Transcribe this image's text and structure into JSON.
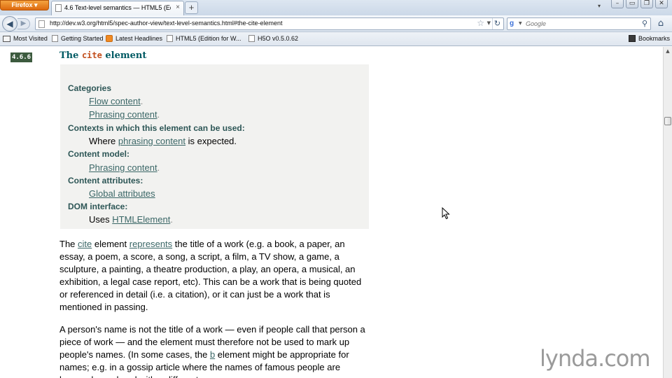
{
  "browser": {
    "app_button": "Firefox",
    "tab": {
      "title": "4.6 Text-level semantics — HTML5 (Editi...",
      "close": "×"
    },
    "new_tab": "+",
    "list_tabs": "▾",
    "window_controls": {
      "minimize": "–",
      "restore": "▭",
      "maximize": "❐",
      "close": "✕"
    },
    "nav": {
      "back": "◀",
      "forward": "▶",
      "url": "http://dev.w3.org/html5/spec-author-view/text-level-semantics.html#the-cite-element",
      "star": "☆",
      "history_drop": "▼",
      "reload": "↻"
    },
    "search": {
      "engine_icon": "g",
      "engine_drop": "▼",
      "placeholder": "Google",
      "go": "⚲"
    },
    "home": "⌂",
    "bookmarks": [
      {
        "label": "Most Visited",
        "icon": "folder-icon"
      },
      {
        "label": "Getting Started",
        "icon": "page-icon"
      },
      {
        "label": "Latest Headlines",
        "icon": "rss-icon"
      },
      {
        "label": "HTML5 (Edition for W...",
        "icon": "page-icon"
      },
      {
        "label": "H5O v0.5.0.62",
        "icon": "page-icon"
      }
    ],
    "bookmarks_menu": "Bookmarks"
  },
  "page": {
    "section_number": "4.6.6",
    "heading": {
      "prefix": "The ",
      "code": "cite",
      "suffix": " element"
    },
    "definition": {
      "categories_label": "Categories",
      "categories": [
        "Flow content",
        "Phrasing content"
      ],
      "contexts_label": "Contexts in which this element can be used:",
      "contexts": {
        "before": "Where ",
        "link": "phrasing content",
        "after": " is expected."
      },
      "content_model_label": "Content model:",
      "content_model": "Phrasing content",
      "attributes_label": "Content attributes:",
      "attributes": "Global attributes",
      "dom_label": "DOM interface:",
      "dom": {
        "before": "Uses ",
        "link": "HTMLElement"
      },
      "period": "."
    },
    "para1": {
      "w1": "The ",
      "link1": "cite",
      "w2": " element ",
      "link2": "represents",
      "w3": " the title of a work (e.g. a book, a paper, an essay, a poem, a score, a song, a script, a film, a TV show, a game, a sculpture, a painting, a theatre production, a play, an opera, a musical, an exhibition, a legal case report, etc). This can be a work that is being quoted or referenced in detail (i.e. a citation), or it can just be a work that is mentioned in passing."
    },
    "para2": {
      "w1": "A person's name is not the title of a work — even if people call that person a piece of work — and the element must therefore not be used to mark up people's names. (In some cases, the ",
      "link1": "b",
      "w2": " element might be appropriate for names; e.g. in a gossip article where the names of famous people are keywords rendered with a different"
    }
  },
  "watermark": "lynda.com",
  "scrollbar": {
    "up": "▲"
  }
}
